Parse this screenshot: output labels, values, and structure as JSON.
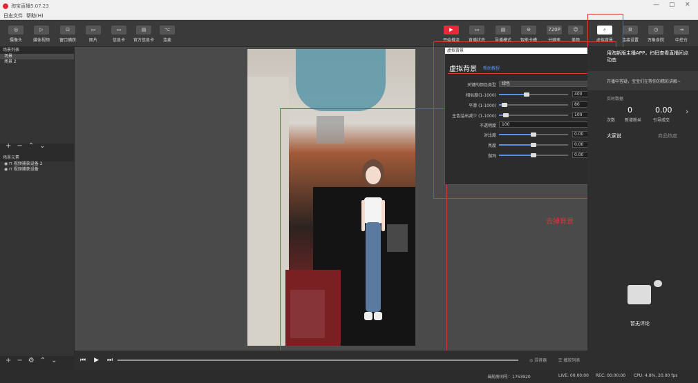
{
  "window": {
    "title": "淘宝直播5.07.23",
    "min": "—",
    "max": "▢",
    "close": "✕"
  },
  "menu": [
    "日志文件",
    "帮助(H)"
  ],
  "toolbar_left": [
    {
      "label": "摄像头",
      "icon": "camera-icon"
    },
    {
      "label": "媒体视频",
      "icon": "play-icon"
    },
    {
      "label": "窗口捕获",
      "icon": "window-icon"
    },
    {
      "label": "图片",
      "icon": "image-icon"
    },
    {
      "label": "信息卡",
      "icon": "card-icon"
    },
    {
      "label": "官方信息卡",
      "icon": "official-card-icon"
    },
    {
      "label": "连麦",
      "icon": "link-mic-icon"
    }
  ],
  "toolbar_right": [
    {
      "label": "开始推流",
      "icon": "start-stream-icon"
    },
    {
      "label": "直播状态",
      "icon": "status-icon"
    },
    {
      "label": "导播模式",
      "icon": "director-icon"
    },
    {
      "label": "智能卡槽",
      "icon": "smart-slot-icon"
    },
    {
      "label": "分辨率",
      "icon": "resolution-icon",
      "glyph": "720P"
    },
    {
      "label": "美颜",
      "icon": "beauty-icon"
    },
    {
      "label": "虚拟背景",
      "icon": "virtual-bg-icon"
    },
    {
      "label": "连接设置",
      "icon": "settings-icon"
    },
    {
      "label": "万象食院",
      "icon": "clock-icon"
    },
    {
      "label": "中控台",
      "icon": "console-icon"
    }
  ],
  "scene_panel": {
    "title": "场景列表",
    "items": [
      "场景",
      "场景 2"
    ]
  },
  "source_panel": {
    "title": "场景元素",
    "items": [
      "视频捕获设备 2",
      "视频捕获设备"
    ]
  },
  "popup": {
    "title": "虚拟背景",
    "close": "x",
    "header": "虚拟背景",
    "link": "帮助教程",
    "key_color_label": "关键的颜色类型",
    "key_color_value": "绿色",
    "rows": [
      {
        "label": "相似度(1-1000)",
        "value": "400",
        "level": 0.4
      },
      {
        "label": "平滑 (1-1000)",
        "value": "80",
        "level": 0.08
      },
      {
        "label": "主色溢出减少 (1-1000)",
        "value": "100",
        "level": 0.1
      }
    ],
    "opacity_label": "不透明度",
    "opacity_value": "100",
    "rows2": [
      {
        "label": "对比度",
        "value": "0.00",
        "level": 0.5
      },
      {
        "label": "亮度",
        "value": "0.00",
        "level": 0.5
      },
      {
        "label": "伽玛",
        "value": "0.00",
        "level": 0.5
      }
    ]
  },
  "right_panel": {
    "promo": "用淘新版主播APP，扫码查看直播间点动态",
    "tip": "开播中答疑，宝宝们在等你的精彩讲解~",
    "data_label": "实时数据",
    "stats": [
      {
        "value": "0",
        "label": "新增粉丝"
      },
      {
        "value": "0.00",
        "label": "引导成交"
      }
    ],
    "stat_left": "次数",
    "tabs": [
      "大家说",
      "商品热度"
    ],
    "empty": "暂无评论"
  },
  "annotation": "去掉背景",
  "playback": {
    "audio": "◎ 混音器",
    "list": "☰ 播放列表"
  },
  "status": {
    "room": "当前房间号：1753920",
    "live": "LIVE: 00:00:00",
    "rec": "REC: 00:00:00",
    "cpu": "CPU: 4.8%, 20.00 fps"
  }
}
